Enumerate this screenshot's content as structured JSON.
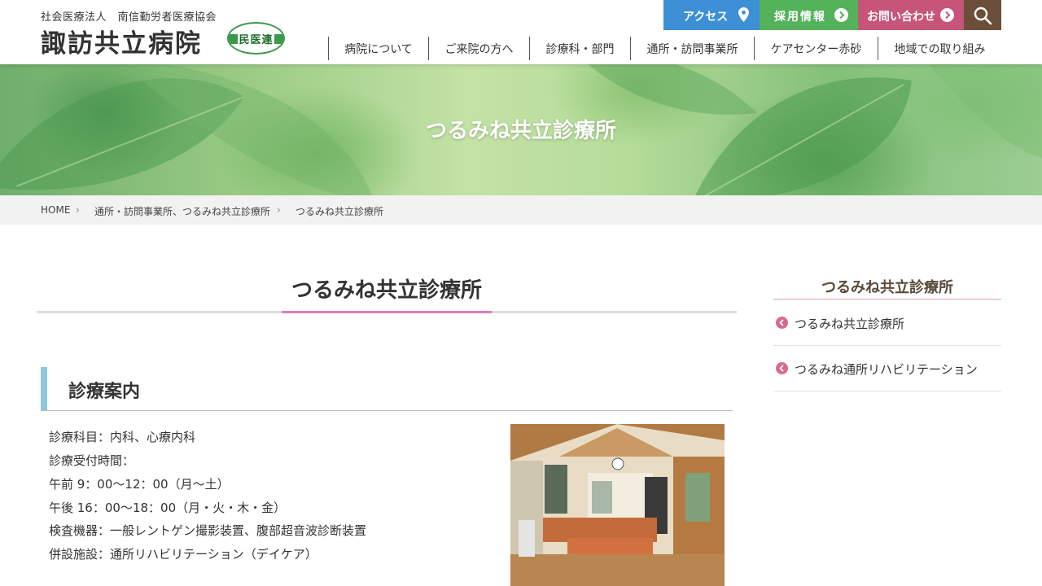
{
  "header": {
    "logo_sub": "社会医療法人　南信勤労者医療協会",
    "logo_main": "諏訪共立病院",
    "logo_badge": "民医連",
    "top_buttons": {
      "access": "アクセス",
      "recruit": "採用情報",
      "contact": "お問い合わせ"
    },
    "nav": [
      {
        "label": "病院について"
      },
      {
        "label": "ご来院の方へ"
      },
      {
        "label": "診療科・部門"
      },
      {
        "label": "通所・訪問事業所"
      },
      {
        "label": "ケアセンター赤砂"
      },
      {
        "label": "地域での取り組み"
      }
    ]
  },
  "hero": {
    "title": "つるみね共立診療所"
  },
  "breadcrumb": [
    {
      "label": "HOME"
    },
    {
      "label": "通所・訪問事業所、つるみね共立診療所"
    },
    {
      "label": "つるみね共立診療所"
    }
  ],
  "main": {
    "page_title": "つるみね共立診療所",
    "section_heading": "診療案内",
    "info_lines": [
      "診療科目：内科、心療内科",
      "診療受付時間：",
      "午前 9：00〜12：00（月〜土）",
      "午後 16：00〜18：00（月・火・木・金）",
      "検査機器：一般レントゲン撮影装置、腹部超音波診断装置",
      "併設施設：通所リハビリテーション（デイケア）"
    ]
  },
  "sidebar": {
    "title": "つるみね共立診療所",
    "items": [
      {
        "label": "つるみね共立診療所"
      },
      {
        "label": "つるみね通所リハビリテーション"
      }
    ]
  },
  "colors": {
    "access": "#3d8fd6",
    "recruit": "#54b35a",
    "contact": "#c65579",
    "search": "#6b4f3a",
    "title_accent": "#e07dc0",
    "section_bar": "#8bc8d8",
    "sidebar_dot": "#d96a8c"
  }
}
